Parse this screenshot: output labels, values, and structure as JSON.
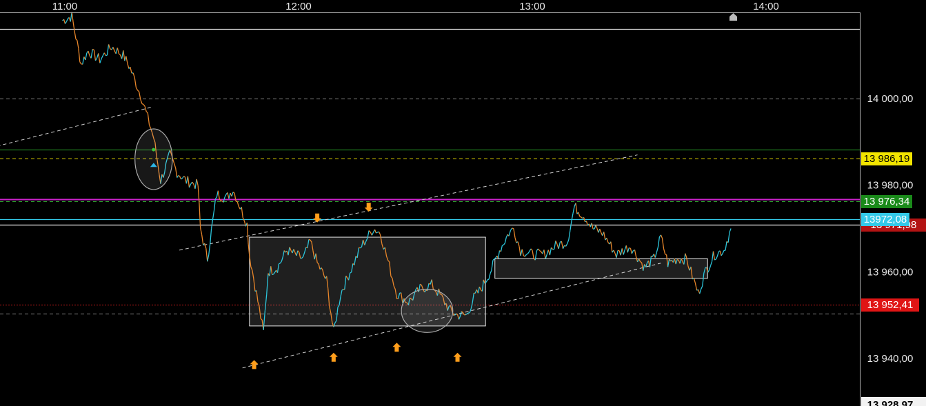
{
  "chart_data": {
    "type": "candlestick",
    "x_ticks": [
      "11:00",
      "12:00",
      "13:00",
      "14:00"
    ],
    "y_ticks": [
      "14 000,00",
      "13 980,00",
      "13 960,00",
      "13 940,00"
    ],
    "ylim": [
      13928.97,
      14022
    ],
    "price_labels": {
      "resistance": "13 986,19",
      "green_level": "13 976,34",
      "last_price": "13972,08",
      "hidden_price": "13 971,98",
      "support": "13 952,41",
      "bottom": "13 928,97"
    },
    "levels": [
      {
        "value": 14016,
        "color": "#dddddd",
        "style": "solid"
      },
      {
        "value": 14000,
        "color": "#888888",
        "style": "dash"
      },
      {
        "value": 13988.2,
        "color": "#1f7a1f",
        "style": "solid"
      },
      {
        "value": 13986.19,
        "color": "#e6d800",
        "style": "dash"
      },
      {
        "value": 13976.8,
        "color": "#cc22cc",
        "style": "solid"
      },
      {
        "value": 13976.34,
        "color": "#2fa52f",
        "style": "dash"
      },
      {
        "value": 13972.08,
        "color": "#33c9e8",
        "style": "solid"
      },
      {
        "value": 13970.9,
        "color": "#eeeeee",
        "style": "solid"
      },
      {
        "value": 13952.41,
        "color": "#d11b1b",
        "style": "dot"
      },
      {
        "value": 13950.4,
        "color": "#888888",
        "style": "dash"
      }
    ],
    "series": [
      {
        "points": [
          [
            10.99,
            14018
          ],
          [
            11.03,
            14019
          ],
          [
            11.07,
            14008
          ],
          [
            11.1,
            14011
          ],
          [
            11.15,
            14009
          ],
          [
            11.2,
            14012
          ],
          [
            11.25,
            14010
          ],
          [
            11.28,
            14007
          ],
          [
            11.33,
            14000
          ],
          [
            11.38,
            13991
          ],
          [
            11.41,
            13981
          ],
          [
            11.45,
            13987
          ],
          [
            11.48,
            13983
          ],
          [
            11.52,
            13981
          ],
          [
            11.57,
            13980
          ],
          [
            11.58,
            13970
          ],
          [
            11.61,
            13963
          ],
          [
            11.65,
            13978
          ],
          [
            11.69,
            13977
          ],
          [
            11.72,
            13979
          ],
          [
            11.78,
            13971
          ],
          [
            11.79,
            13964
          ],
          [
            11.85,
            13946
          ],
          [
            11.87,
            13960
          ],
          [
            11.91,
            13961
          ],
          [
            11.95,
            13965
          ],
          [
            12.02,
            13963
          ],
          [
            12.05,
            13967
          ],
          [
            12.08,
            13962
          ],
          [
            12.12,
            13958
          ],
          [
            12.15,
            13946
          ],
          [
            12.18,
            13955
          ],
          [
            12.22,
            13960
          ],
          [
            12.27,
            13966
          ],
          [
            12.32,
            13970
          ],
          [
            12.35,
            13969
          ],
          [
            12.37,
            13965
          ],
          [
            12.42,
            13955
          ],
          [
            12.47,
            13953
          ],
          [
            12.52,
            13956
          ],
          [
            12.57,
            13957
          ],
          [
            12.6,
            13955
          ],
          [
            12.65,
            13951
          ],
          [
            12.68,
            13950
          ],
          [
            12.72,
            13950
          ],
          [
            12.75,
            13954
          ],
          [
            12.78,
            13956
          ],
          [
            12.82,
            13960
          ],
          [
            12.86,
            13965
          ],
          [
            12.9,
            13969
          ],
          [
            12.92,
            13970
          ],
          [
            12.95,
            13965
          ],
          [
            13.0,
            13964
          ],
          [
            13.05,
            13964
          ],
          [
            13.1,
            13966
          ],
          [
            13.15,
            13967
          ],
          [
            13.18,
            13975
          ],
          [
            13.22,
            13973
          ],
          [
            13.26,
            13970
          ],
          [
            13.3,
            13969
          ],
          [
            13.36,
            13964
          ],
          [
            13.42,
            13966
          ],
          [
            13.48,
            13961
          ],
          [
            13.52,
            13963
          ],
          [
            13.55,
            13968
          ],
          [
            13.58,
            13962
          ],
          [
            13.62,
            13963
          ],
          [
            13.66,
            13963
          ],
          [
            13.71,
            13955
          ],
          [
            13.74,
            13960
          ],
          [
            13.78,
            13964
          ],
          [
            13.82,
            13965
          ],
          [
            13.85,
            13970
          ]
        ]
      }
    ],
    "boxes": [
      {
        "t0": 11.79,
        "t1": 12.8,
        "y0": 13968,
        "y1": 13947.5
      },
      {
        "t0": 12.84,
        "t1": 13.75,
        "y0": 13963,
        "y1": 13958.5
      }
    ],
    "trendlines": [
      {
        "t0": 10.71,
        "y0": 13989,
        "t1": 11.37,
        "y1": 13998
      },
      {
        "t0": 11.49,
        "y0": 13965,
        "t1": 13.45,
        "y1": 13987
      },
      {
        "t0": 11.76,
        "y0": 13937.8,
        "t1": 13.55,
        "y1": 13962
      }
    ],
    "arrows_up": [
      [
        11.81,
        13938.5
      ],
      [
        12.15,
        13940.2
      ],
      [
        12.42,
        13942.5
      ],
      [
        12.68,
        13940.2
      ]
    ],
    "arrows_down": [
      [
        12.08,
        13972.5
      ],
      [
        12.3,
        13975
      ]
    ],
    "circles": [
      {
        "t": 11.38,
        "y": 13986,
        "rt": 0.08,
        "ry": 7
      },
      {
        "t": 12.55,
        "y": 13951,
        "rt": 0.11,
        "ry": 5
      }
    ],
    "marker_icon": "home-icon"
  }
}
